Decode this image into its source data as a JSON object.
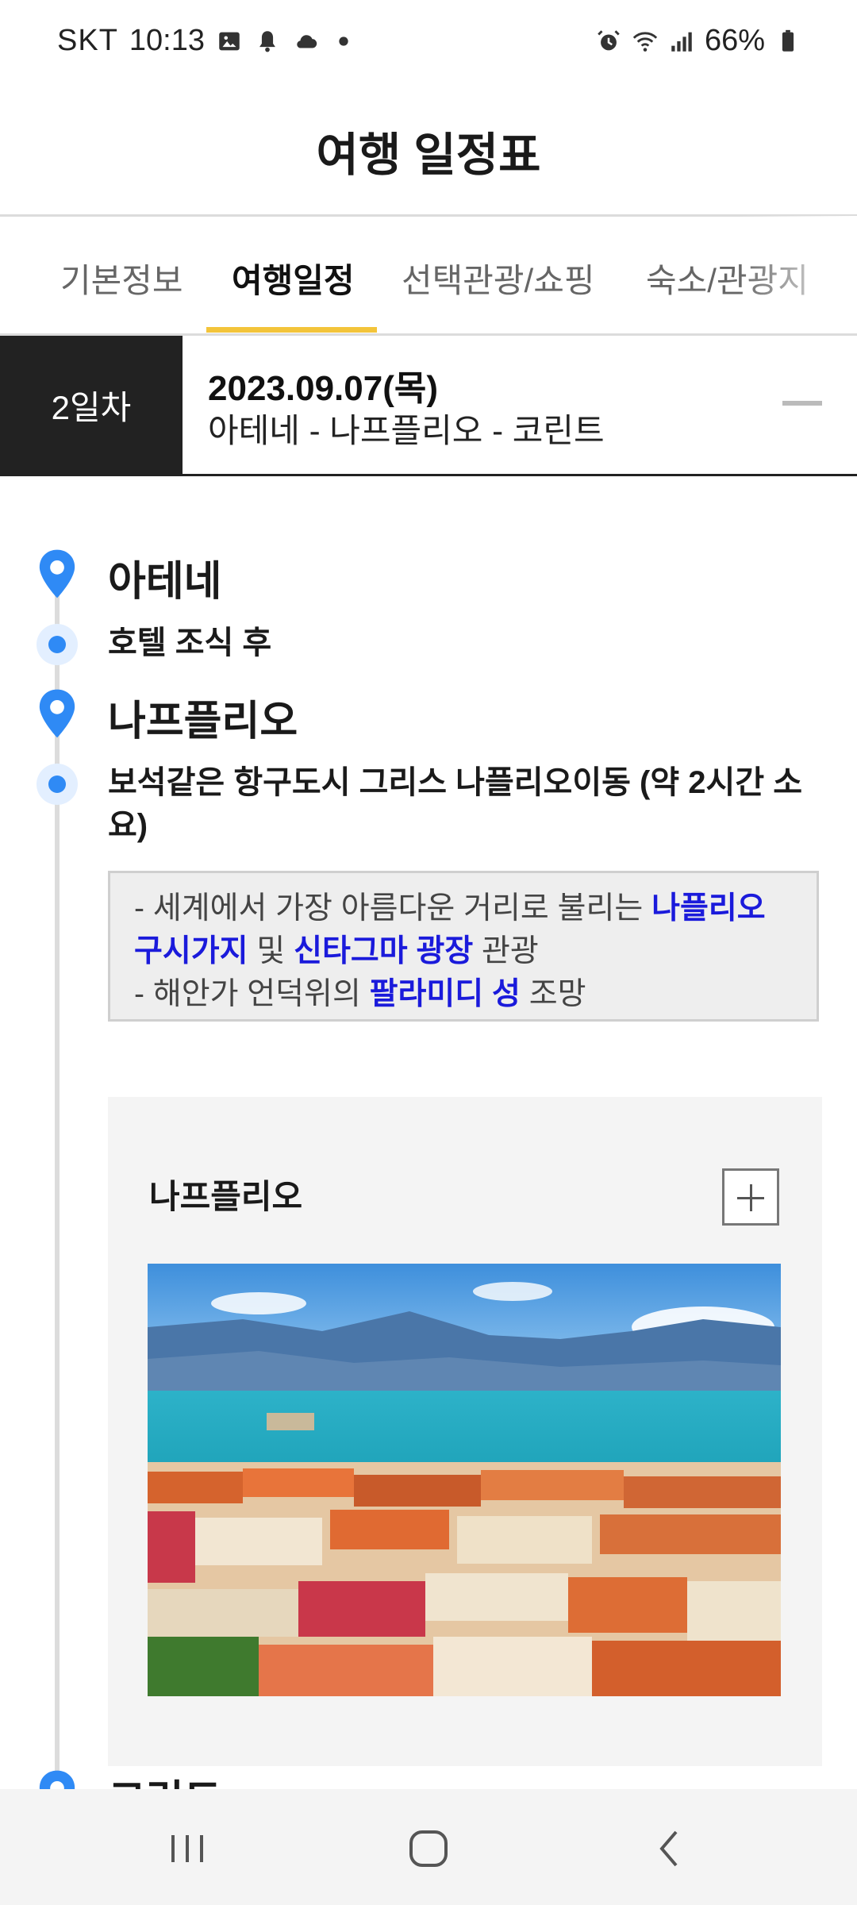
{
  "status_bar": {
    "carrier": "SKT",
    "time": "10:13",
    "battery": "66%"
  },
  "header": {
    "title": "여행 일정표"
  },
  "tabs": [
    {
      "label": "기본정보",
      "active": false
    },
    {
      "label": "여행일정",
      "active": true
    },
    {
      "label": "선택관광/쇼핑",
      "active": false
    },
    {
      "label": "숙소/관광지",
      "active": false
    }
  ],
  "day": {
    "badge": "2일차",
    "date": "2023.09.07(목)",
    "route": "아테네 - 나프플리오 - 코린트"
  },
  "timeline": {
    "place1": "아테네",
    "step1": "호텔 조식 후",
    "place2": "나프플리오",
    "step2": "보석같은 항구도시 그리스 나플리오이동 (약 2시간 소요)",
    "place3": "코린트"
  },
  "note": {
    "line1_pre": "- 세계에서 가장 아름다운 거리로 불리는 ",
    "line1_hl1": "나플리오 구시가지",
    "line1_mid": " 및 ",
    "line1_hl2": "신타그마 광장",
    "line1_post": " 관광",
    "line2_pre": "- 해안가 언덕위의 ",
    "line2_hl": "팔라미디 성",
    "line2_post": " 조망"
  },
  "card": {
    "title": "나프플리오"
  },
  "colors": {
    "accent": "#f3c43a",
    "pin": "#2f8af5",
    "highlight": "#1a1adb",
    "day_badge_bg": "#222222"
  }
}
